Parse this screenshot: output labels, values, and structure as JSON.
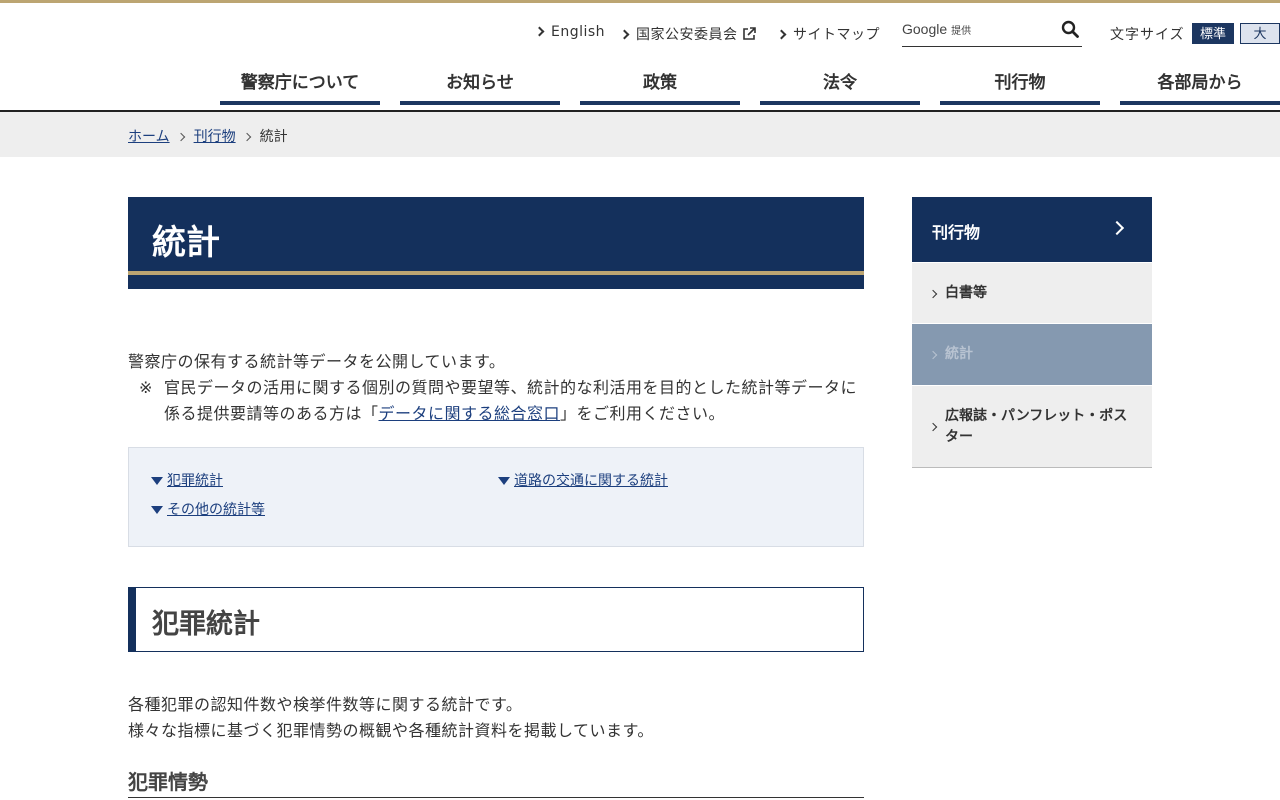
{
  "utility": {
    "english": "English",
    "npsc": "国家公安委員会",
    "sitemap": "サイトマップ",
    "search_brand": "Google",
    "search_provided": "提供",
    "font_size_label": "文字サイズ",
    "font_standard": "標準",
    "font_large": "大"
  },
  "gnav": {
    "items": [
      "警察庁について",
      "お知らせ",
      "政策",
      "法令",
      "刊行物",
      "各部局から"
    ]
  },
  "breadcrumb": {
    "home": "ホーム",
    "publications": "刊行物",
    "current": "統計"
  },
  "main": {
    "title": "統計",
    "intro": "警察庁の保有する統計等データを公開しています。",
    "note_mark": "※",
    "note_pre": "官民データの活用に関する個別の質問や要望等、統計的な利活用を目的とした統計等データに係る提供要請等のある方は「",
    "note_link": "データに関する総合窓口",
    "note_post": "」をご利用ください。",
    "toc": {
      "crime": "犯罪統計",
      "traffic": "道路の交通に関する統計",
      "other": "その他の統計等"
    },
    "section_crime": {
      "title": "犯罪統計",
      "desc1": "各種犯罪の認知件数や検挙件数等に関する統計です。",
      "desc2": "様々な指標に基づく犯罪情勢の概観や各種統計資料を掲載しています。",
      "sub": "犯罪情勢"
    }
  },
  "sidebar": {
    "header": "刊行物",
    "items": [
      "白書等",
      "統計",
      "広報誌・パンフレット・ポスター"
    ]
  },
  "colors": {
    "navy": "#14305c",
    "gold": "#bca572",
    "link": "#1c3f7e"
  }
}
